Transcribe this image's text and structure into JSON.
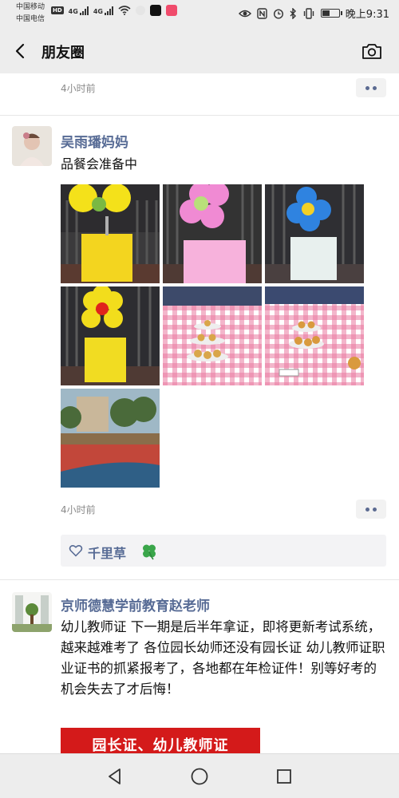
{
  "status_bar": {
    "carrier1": "中国移动",
    "carrier2": "中国电信",
    "hd": "HD",
    "net1": "4G",
    "net2": "4G",
    "time": "晚上9:31",
    "battery_level": 0.45
  },
  "nav": {
    "title": "朋友圈"
  },
  "prev_post": {
    "time": "4小时前"
  },
  "post1": {
    "author": "吴雨璠妈妈",
    "text": "品餐会准备中",
    "time": "4小时前",
    "photos": [
      {
        "icon": "photo-yellow-balloon-sign"
      },
      {
        "icon": "photo-pink-balloon-sign"
      },
      {
        "icon": "photo-blue-balloon-sign"
      },
      {
        "icon": "photo-yellow-flower-balloon-sign"
      },
      {
        "icon": "photo-cupcake-stand"
      },
      {
        "icon": "photo-cupcake-stand-2"
      },
      {
        "icon": "photo-playground"
      }
    ],
    "likes": "千里草",
    "like_emoji": "four-leaf-clover"
  },
  "post2": {
    "author": "京师德慧学前教育赵老师",
    "text": "幼儿教师证 下一期是后半年拿证，即将更新考试系统，越来越难考了 各位园长幼师还没有园长证 幼儿教师证职业证书的抓紧报考了，各地都在年检证件！别等好考的机会失去了才后悔！",
    "promo": "园长证、幼儿教师证"
  },
  "colors": {
    "link": "#576b95",
    "background_bar": "#ededed",
    "promo_red": "#d41a1a"
  }
}
